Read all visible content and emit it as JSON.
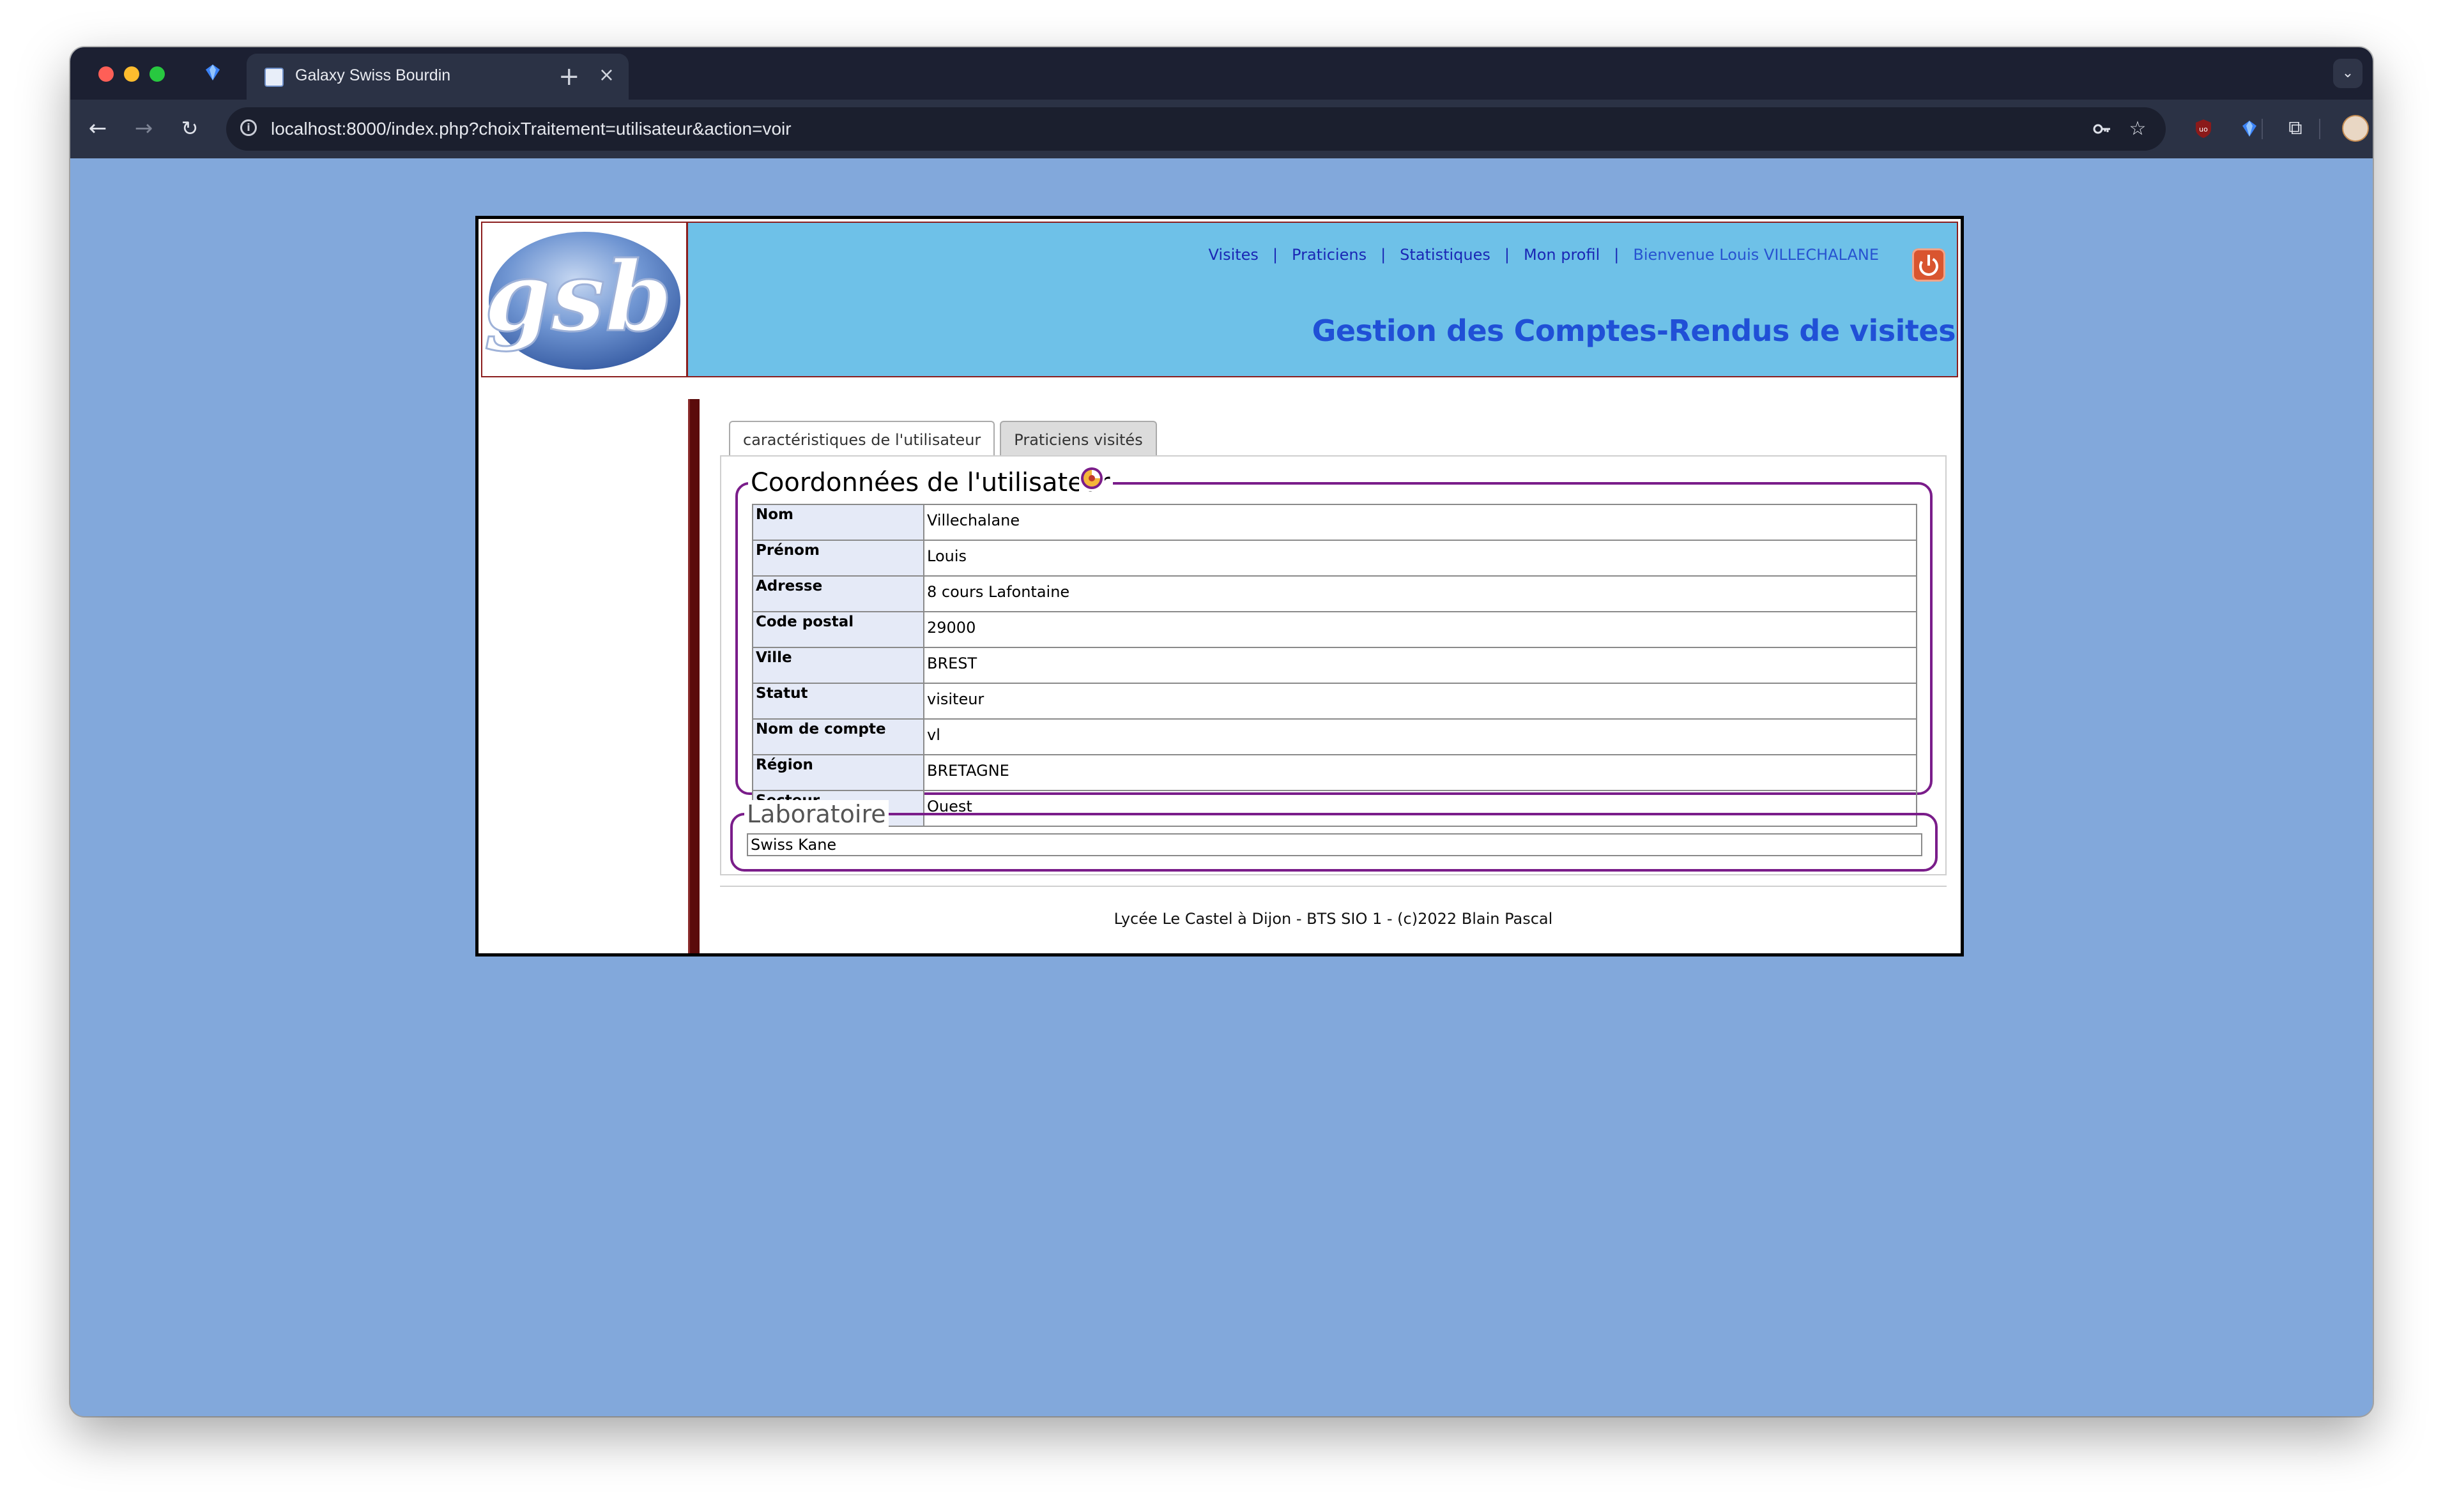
{
  "browser": {
    "tab_title": "Galaxy Swiss Bourdin",
    "tab_close": "×",
    "new_tab": "+",
    "url": "localhost:8000/index.php?choixTraitement=utilisateur&action=voir"
  },
  "header": {
    "logo_text": "gsb",
    "menu": [
      {
        "label": "Visites"
      },
      {
        "label": "Praticiens"
      },
      {
        "label": "Statistiques"
      },
      {
        "label": "Mon profil"
      }
    ],
    "separator": "|",
    "welcome": "Bienvenue Louis VILLECHALANE",
    "app_title": "Gestion des Comptes-Rendus de visites"
  },
  "tabs": [
    {
      "label": "caractéristiques de l'utilisateur",
      "active": true
    },
    {
      "label": "Praticiens visités",
      "active": false
    }
  ],
  "coordonnees": {
    "legend": "Coordonnées de l'utilisateur",
    "rows": [
      {
        "label": "Nom",
        "value": "Villechalane"
      },
      {
        "label": "Prénom",
        "value": "Louis"
      },
      {
        "label": "Adresse",
        "value": "8 cours Lafontaine"
      },
      {
        "label": "Code postal",
        "value": "29000"
      },
      {
        "label": "Ville",
        "value": "BREST"
      },
      {
        "label": "Statut",
        "value": "visiteur"
      },
      {
        "label": "Nom de compte",
        "value": "vl"
      },
      {
        "label": "Région",
        "value": "BRETAGNE"
      },
      {
        "label": "Secteur",
        "value": "Ouest"
      }
    ]
  },
  "laboratoire": {
    "legend": "Laboratoire",
    "value": "Swiss Kane"
  },
  "footer": {
    "text": "Lycée Le Castel à Dijon - BTS SIO 1 - (c)2022 Blain Pascal"
  },
  "colors": {
    "page_background": "#82a8db",
    "header_background": "#6ec1e8",
    "title_color": "#2050d6",
    "fieldset_border": "#7a1d8a",
    "sidebar_bar": "#5a0b0b"
  }
}
